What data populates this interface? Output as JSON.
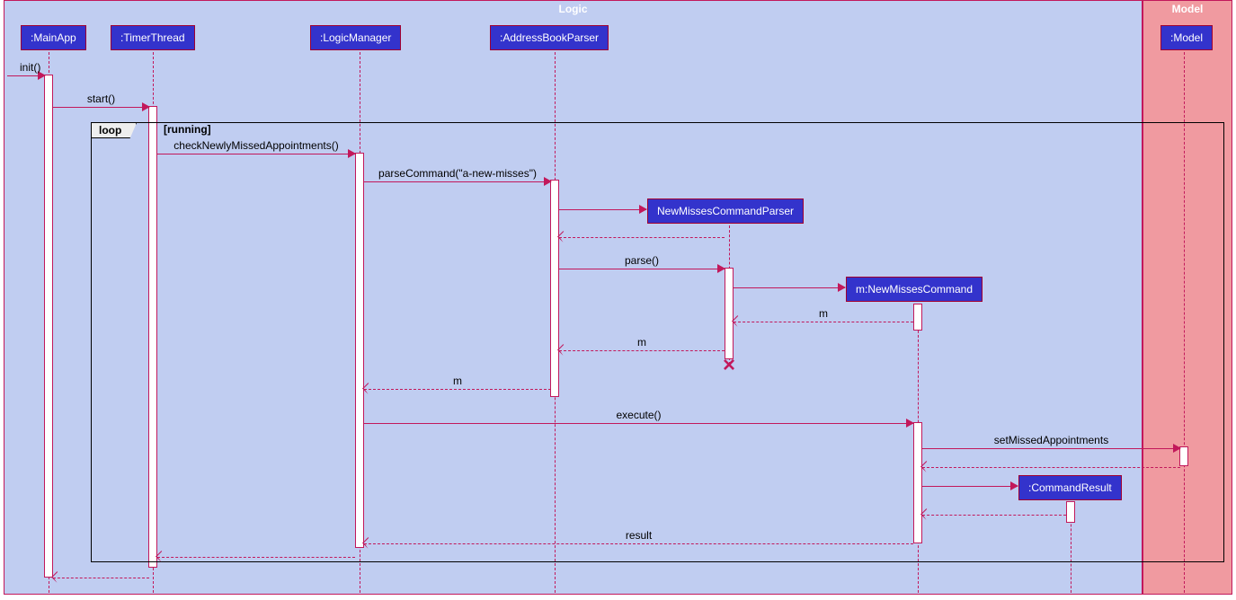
{
  "frames": {
    "logic": "Logic",
    "model": "Model"
  },
  "participants": {
    "mainapp": ":MainApp",
    "timer": ":TimerThread",
    "logicmgr": ":LogicManager",
    "abparser": ":AddressBookParser",
    "nmparser": "NewMissesCommandParser",
    "nmcmd": "m:NewMissesCommand",
    "cmdresult": ":CommandResult",
    "model": ":Model"
  },
  "messages": {
    "init": "init()",
    "start": "start()",
    "check": "checkNewlyMissedAppointments()",
    "parsecmd": "parseCommand(\"a-new-misses\")",
    "parse": "parse()",
    "m1": "m",
    "m2": "m",
    "m3": "m",
    "execute": "execute()",
    "setmissed": "setMissedAppointments",
    "result": "result"
  },
  "loop": {
    "label": "loop",
    "guard": "[running]"
  }
}
